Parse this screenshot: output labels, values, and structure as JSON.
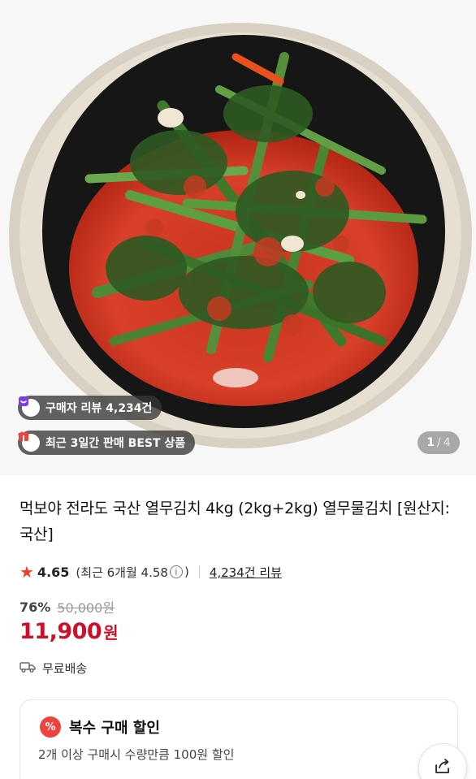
{
  "product_image": {
    "badges": {
      "reviews": "구매자 리뷰 4,234건",
      "best": "최근 3일간 판매 BEST 상품"
    },
    "pager": {
      "current": "1",
      "separator": "/",
      "total": "4"
    },
    "icons": [
      "review-badge-icon",
      "gift-icon"
    ]
  },
  "product": {
    "title": "먹보야 전라도 국산 열무김치 4kg (2kg+2kg) 열무물김치 [원산지:국산]",
    "rating": {
      "score": "4.65",
      "recent_prefix": "(최근 6개월 4.58",
      "recent_suffix": ")",
      "info_glyph": "i",
      "review_count_link": "4,234건 리뷰"
    },
    "price": {
      "discount_rate": "76%",
      "original": "50,000원",
      "sale_number": "11,900",
      "sale_unit": "원"
    },
    "shipping": "무료배송"
  },
  "discount_card": {
    "icon_text": "%",
    "title": "복수 구매 할인",
    "description": "2개 이상 구매시 수량만큼 100원 할인"
  },
  "colors": {
    "accent_red": "#d0102a",
    "star": "#f03e2f",
    "review_badge_icon": "#7b3fe4",
    "gift_icon": "#f0423c"
  }
}
